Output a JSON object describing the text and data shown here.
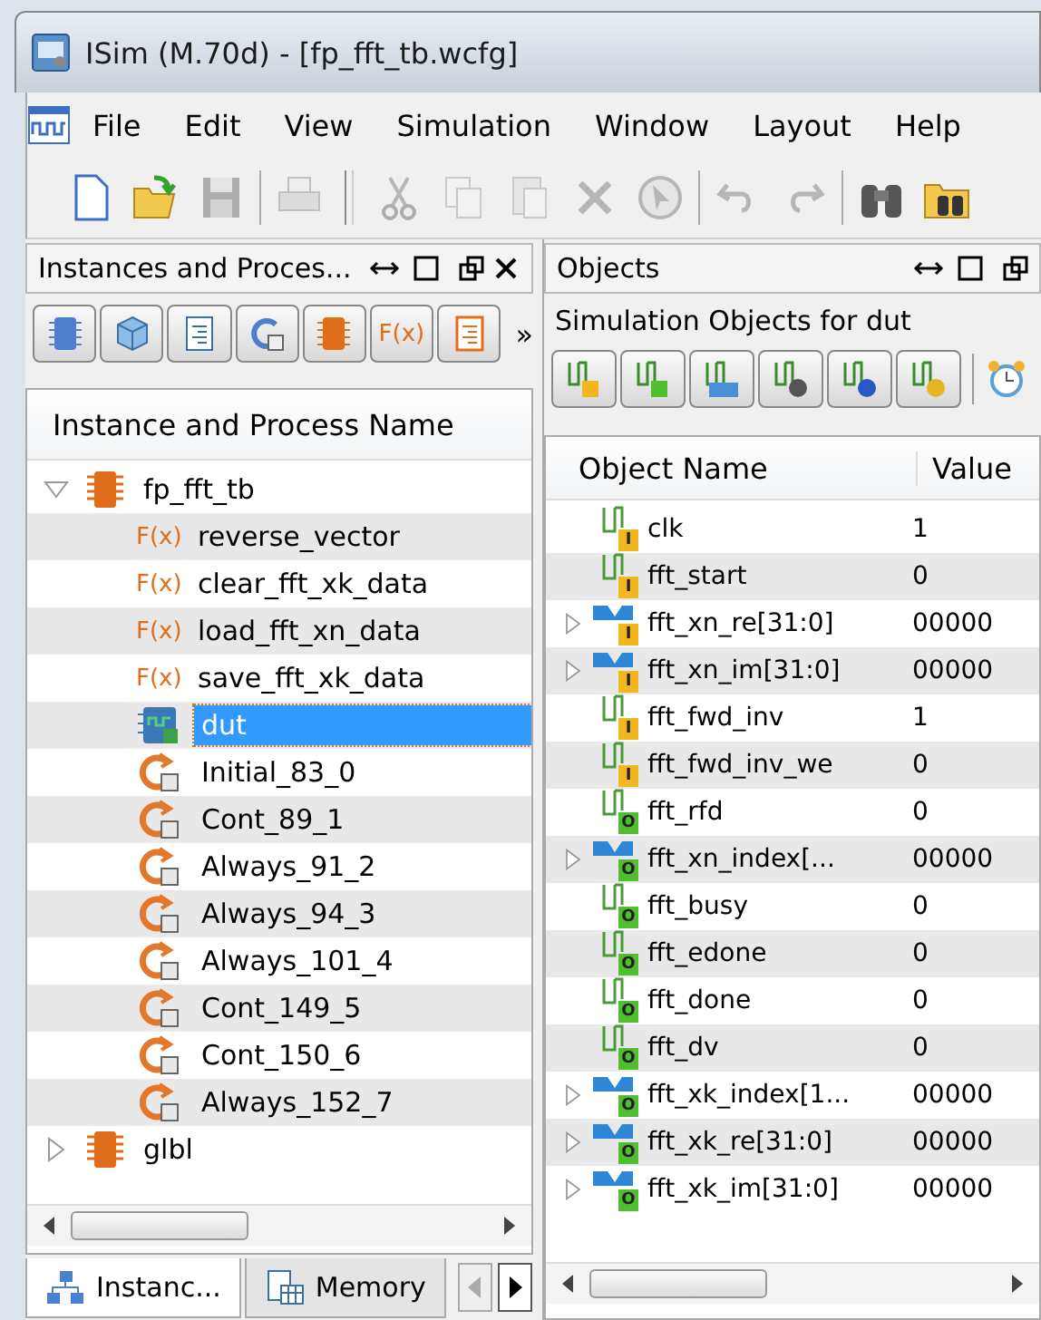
{
  "window": {
    "title": "ISim (M.70d) - [fp_fft_tb.wcfg]"
  },
  "menu": [
    {
      "label": "File"
    },
    {
      "label": "Edit"
    },
    {
      "label": "View"
    },
    {
      "label": "Simulation"
    },
    {
      "label": "Window"
    },
    {
      "label": "Layout"
    },
    {
      "label": "Help"
    }
  ],
  "toolbar": [
    {
      "kind": "new",
      "disabled": false
    },
    {
      "kind": "open",
      "disabled": false
    },
    {
      "kind": "save",
      "disabled": true
    },
    {
      "kind": "sep"
    },
    {
      "kind": "print",
      "disabled": true
    },
    {
      "kind": "grip"
    },
    {
      "kind": "cut",
      "disabled": true
    },
    {
      "kind": "copy",
      "disabled": true
    },
    {
      "kind": "paste",
      "disabled": true
    },
    {
      "kind": "delete",
      "disabled": true
    },
    {
      "kind": "cursor",
      "disabled": true
    },
    {
      "kind": "sep"
    },
    {
      "kind": "undo",
      "disabled": true
    },
    {
      "kind": "redo",
      "disabled": true
    },
    {
      "kind": "sep"
    },
    {
      "kind": "find",
      "disabled": false
    },
    {
      "kind": "findfolder",
      "disabled": false
    }
  ],
  "left_panel": {
    "title": "Instances and Proces...",
    "toolbar": [
      {
        "kind": "chip-outline"
      },
      {
        "kind": "cube"
      },
      {
        "kind": "doc"
      },
      {
        "kind": "process"
      },
      {
        "kind": "chip"
      },
      {
        "kind": "function",
        "label": "F(x)"
      },
      {
        "kind": "document"
      }
    ],
    "overflow": "»",
    "column": "Instance and Process Name",
    "tree": [
      {
        "name": "fp_fft_tb",
        "kind": "module",
        "expanded": true,
        "selected": false,
        "children": [
          {
            "name": "reverse_vector",
            "kind": "function",
            "badge": "F(x)",
            "selected": false
          },
          {
            "name": "clear_fft_xk_data",
            "kind": "function",
            "badge": "F(x)",
            "selected": false
          },
          {
            "name": "load_fft_xn_data",
            "kind": "function",
            "badge": "F(x)",
            "selected": false
          },
          {
            "name": "save_fft_xk_data",
            "kind": "function",
            "badge": "F(x)",
            "selected": false
          },
          {
            "name": "dut",
            "kind": "instance",
            "selected": true
          },
          {
            "name": "Initial_83_0",
            "kind": "process",
            "selected": false
          },
          {
            "name": "Cont_89_1",
            "kind": "process",
            "selected": false
          },
          {
            "name": "Always_91_2",
            "kind": "process",
            "selected": false
          },
          {
            "name": "Always_94_3",
            "kind": "process",
            "selected": false
          },
          {
            "name": "Always_101_4",
            "kind": "process",
            "selected": false
          },
          {
            "name": "Cont_149_5",
            "kind": "process",
            "selected": false
          },
          {
            "name": "Cont_150_6",
            "kind": "process",
            "selected": false
          },
          {
            "name": "Always_152_7",
            "kind": "process",
            "selected": false
          }
        ]
      },
      {
        "name": "glbl",
        "kind": "module",
        "expanded": false,
        "selected": false
      }
    ],
    "tabs": [
      {
        "label": "Instanc...",
        "kind": "instances",
        "selected": true
      },
      {
        "label": "Memory",
        "kind": "memory",
        "selected": false
      }
    ]
  },
  "right_panel": {
    "title": "Objects",
    "subtitle": "Simulation Objects for dut",
    "toolbar": [
      {
        "kind": "input"
      },
      {
        "kind": "output"
      },
      {
        "kind": "inout"
      },
      {
        "kind": "internal"
      },
      {
        "kind": "constant"
      },
      {
        "kind": "variable"
      }
    ],
    "columns": [
      "Object Name",
      "Value"
    ],
    "rows": [
      {
        "name": "clk",
        "value": "1",
        "kind": "signal",
        "color": "#f3b61f",
        "badge": "I"
      },
      {
        "name": "fft_start",
        "value": "0",
        "kind": "signal",
        "color": "#f3b61f",
        "badge": "I"
      },
      {
        "name": "fft_xn_re[31:0]",
        "value": "00000",
        "kind": "bus",
        "color": "#f3b61f",
        "badge": "I",
        "expanded": false
      },
      {
        "name": "fft_xn_im[31:0]",
        "value": "00000",
        "kind": "bus",
        "color": "#f3b61f",
        "badge": "I",
        "expanded": false
      },
      {
        "name": "fft_fwd_inv",
        "value": "1",
        "kind": "signal",
        "color": "#f3b61f",
        "badge": "I"
      },
      {
        "name": "fft_fwd_inv_we",
        "value": "0",
        "kind": "signal",
        "color": "#f3b61f",
        "badge": "I"
      },
      {
        "name": "fft_rfd",
        "value": "0",
        "kind": "signal",
        "color": "#4fbf2f",
        "badge": "O"
      },
      {
        "name": "fft_xn_index[...",
        "value": "00000",
        "kind": "bus",
        "color": "#4fbf2f",
        "badge": "O",
        "expanded": false
      },
      {
        "name": "fft_busy",
        "value": "0",
        "kind": "signal",
        "color": "#4fbf2f",
        "badge": "O"
      },
      {
        "name": "fft_edone",
        "value": "0",
        "kind": "signal",
        "color": "#4fbf2f",
        "badge": "O"
      },
      {
        "name": "fft_done",
        "value": "0",
        "kind": "signal",
        "color": "#4fbf2f",
        "badge": "O"
      },
      {
        "name": "fft_dv",
        "value": "0",
        "kind": "signal",
        "color": "#4fbf2f",
        "badge": "O"
      },
      {
        "name": "fft_xk_index[1...",
        "value": "00000",
        "kind": "bus",
        "color": "#4fbf2f",
        "badge": "O",
        "expanded": false
      },
      {
        "name": "fft_xk_re[31:0]",
        "value": "00000",
        "kind": "bus",
        "color": "#4fbf2f",
        "badge": "O",
        "expanded": false
      },
      {
        "name": "fft_xk_im[31:0]",
        "value": "00000",
        "kind": "bus",
        "color": "#4fbf2f",
        "badge": "O",
        "expanded": false
      }
    ]
  }
}
